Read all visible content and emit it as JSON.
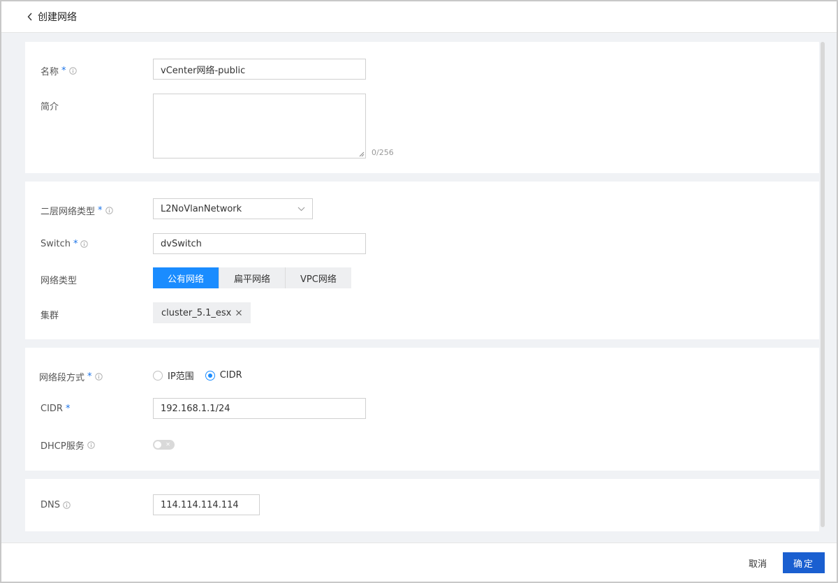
{
  "header": {
    "title": "创建网络"
  },
  "basic": {
    "name_label": "名称",
    "name_value": "vCenter网络-public",
    "desc_label": "简介",
    "desc_counter": "0/256"
  },
  "network": {
    "l2_type_label": "二层网络类型",
    "l2_type_value": "L2NoVlanNetwork",
    "switch_label": "Switch",
    "switch_value": "dvSwitch",
    "net_type_label": "网络类型",
    "net_type_options": [
      "公有网络",
      "扁平网络",
      "VPC网络"
    ],
    "net_type_selected": "公有网络",
    "cluster_label": "集群",
    "cluster_tag": "cluster_5.1_esx"
  },
  "segment": {
    "mode_label": "网络段方式",
    "mode_options": [
      "IP范围",
      "CIDR"
    ],
    "mode_selected": "CIDR",
    "cidr_label": "CIDR",
    "cidr_value": "192.168.1.1/24",
    "dhcp_label": "DHCP服务",
    "dhcp_enabled": false
  },
  "dns": {
    "label": "DNS",
    "value": "114.114.114.114"
  },
  "footer": {
    "cancel_label": "取消",
    "ok_label": "确定"
  },
  "colors": {
    "primary": "#1a8cff",
    "ok_button": "#1a5fd0",
    "required": "#1a73e8"
  }
}
